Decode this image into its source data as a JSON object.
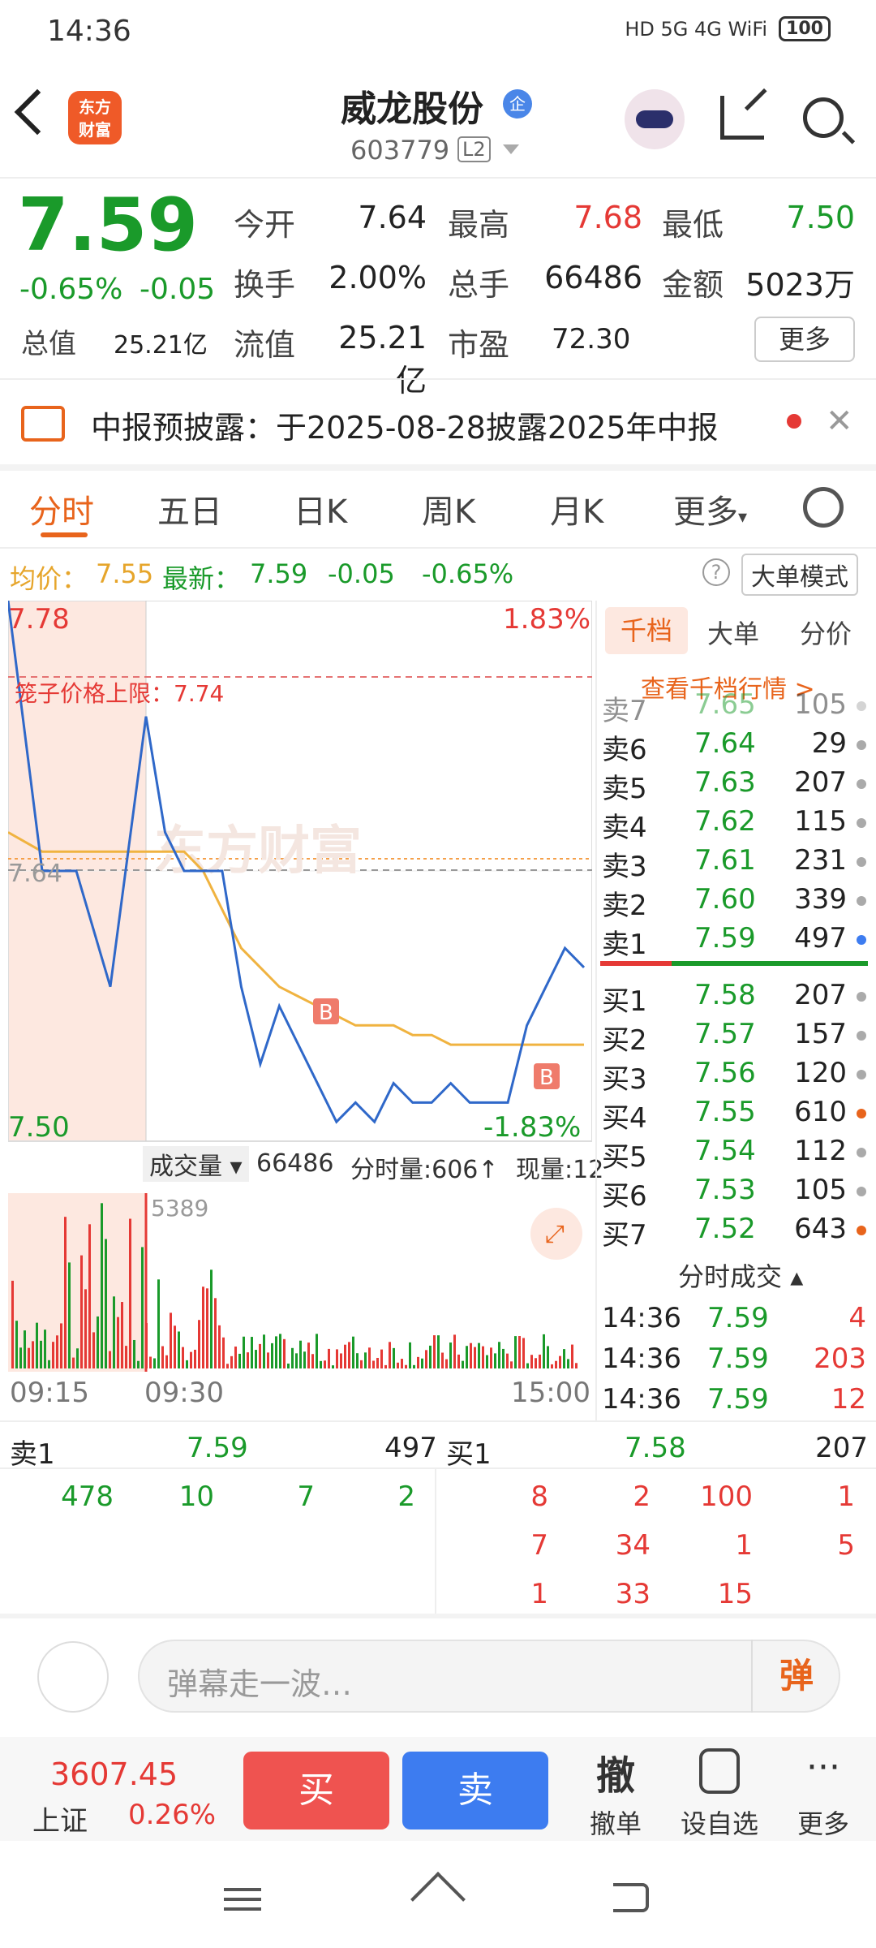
{
  "status": {
    "time": "14:36",
    "icons": "HD 5G 4G WiFi",
    "battery": "100"
  },
  "header": {
    "name": "威龙股份",
    "badge": "企",
    "code": "603779",
    "level": "L2",
    "logo": "东方\n财富"
  },
  "quote": {
    "price": "7.59",
    "change_pct": "-0.65%",
    "change": "-0.05",
    "open_label": "今开",
    "open": "7.64",
    "high_label": "最高",
    "high": "7.68",
    "low_label": "最低",
    "low": "7.50",
    "turnover_label": "换手",
    "turnover": "2.00%",
    "vol_label": "总手",
    "vol": "66486",
    "amount_label": "金额",
    "amount": "5023万",
    "mcap_label": "总值",
    "mcap": "25.21亿",
    "float_label": "流值",
    "float": "25.21亿",
    "pe_label": "市盈",
    "pe": "72.30",
    "more": "更多"
  },
  "notice": {
    "text": "中报预披露：于2025-08-28披露2025年中报"
  },
  "tabs": [
    "分时",
    "五日",
    "日K",
    "周K",
    "月K",
    "更多"
  ],
  "pricebar": {
    "avg_label": "均价：",
    "avg": "7.55",
    "last_label": "最新：",
    "last": "7.59",
    "chg": "-0.05",
    "pct": "-0.65%",
    "mode": "大单模式",
    "help": "?"
  },
  "chart": {
    "top_price": "7.78",
    "top_pct": "1.83%",
    "bottom_price": "7.50",
    "bottom_pct": "-1.83%",
    "ref_price": "7.64",
    "limit_label": "笼子价格上限：7.74",
    "watermark": "东方财富",
    "marker": "B",
    "volume_label": "成交量",
    "volume": "66486",
    "minute_vol": "分时量:606↑",
    "cur_vol": "现量:12",
    "vol_max": "5389",
    "times": [
      "09:15",
      "09:30",
      "15:00"
    ]
  },
  "chart_data": {
    "type": "line",
    "title": "",
    "ylim": [
      7.5,
      7.78
    ],
    "series": [
      {
        "name": "最新",
        "values": [
          7.78,
          7.64,
          7.64,
          7.58,
          7.72,
          7.66,
          7.64,
          7.64,
          7.64,
          7.58,
          7.54,
          7.57,
          7.55,
          7.53,
          7.51,
          7.52,
          7.51,
          7.53,
          7.52,
          7.52,
          7.53,
          7.52,
          7.52,
          7.52,
          7.56,
          7.58,
          7.6,
          7.59
        ]
      },
      {
        "name": "均价",
        "values": [
          7.66,
          7.65,
          7.65,
          7.65,
          7.65,
          7.65,
          7.65,
          7.64,
          7.62,
          7.6,
          7.59,
          7.58,
          7.575,
          7.57,
          7.565,
          7.56,
          7.56,
          7.56,
          7.555,
          7.555,
          7.55,
          7.55,
          7.55,
          7.55,
          7.55,
          7.55,
          7.55,
          7.55
        ]
      }
    ]
  },
  "book": {
    "tabs": [
      "千档",
      "大单",
      "分价"
    ],
    "view": "查看千档行情 >",
    "asks": [
      {
        "label": "卖7",
        "price": "7.65",
        "vol": "105"
      },
      {
        "label": "卖6",
        "price": "7.64",
        "vol": "29"
      },
      {
        "label": "卖5",
        "price": "7.63",
        "vol": "207"
      },
      {
        "label": "卖4",
        "price": "7.62",
        "vol": "115"
      },
      {
        "label": "卖3",
        "price": "7.61",
        "vol": "231"
      },
      {
        "label": "卖2",
        "price": "7.60",
        "vol": "339"
      },
      {
        "label": "卖1",
        "price": "7.59",
        "vol": "497"
      }
    ],
    "bids": [
      {
        "label": "买1",
        "price": "7.58",
        "vol": "207"
      },
      {
        "label": "买2",
        "price": "7.57",
        "vol": "157"
      },
      {
        "label": "买3",
        "price": "7.56",
        "vol": "120"
      },
      {
        "label": "买4",
        "price": "7.55",
        "vol": "610"
      },
      {
        "label": "买5",
        "price": "7.54",
        "vol": "112"
      },
      {
        "label": "买6",
        "price": "7.53",
        "vol": "105"
      },
      {
        "label": "买7",
        "price": "7.52",
        "vol": "643"
      }
    ],
    "trades_label": "分时成交",
    "trades": [
      {
        "time": "14:36",
        "price": "7.59",
        "vol": "4"
      },
      {
        "time": "14:36",
        "price": "7.59",
        "vol": "203"
      },
      {
        "time": "14:36",
        "price": "7.59",
        "vol": "12"
      }
    ]
  },
  "queue": {
    "ask_label": "卖1",
    "ask_price": "7.59",
    "ask_vol": "497",
    "bid_label": "买1",
    "bid_price": "7.58",
    "bid_vol": "207",
    "ask_items": [
      "478",
      "10",
      "7",
      "2"
    ],
    "bid_items": [
      "8",
      "2",
      "100",
      "1",
      "7",
      "34",
      "1",
      "5",
      "1",
      "33",
      "15"
    ]
  },
  "danmu": {
    "placeholder": "弹幕走一波…",
    "button": "弹"
  },
  "toolbar": {
    "index_value": "3607.45",
    "index_name": "上证",
    "index_pct": "0.26%",
    "buy": "买",
    "sell": "卖",
    "cancel_icon": "撤",
    "cancel": "撤单",
    "watch": "设自选",
    "more": "更多"
  }
}
